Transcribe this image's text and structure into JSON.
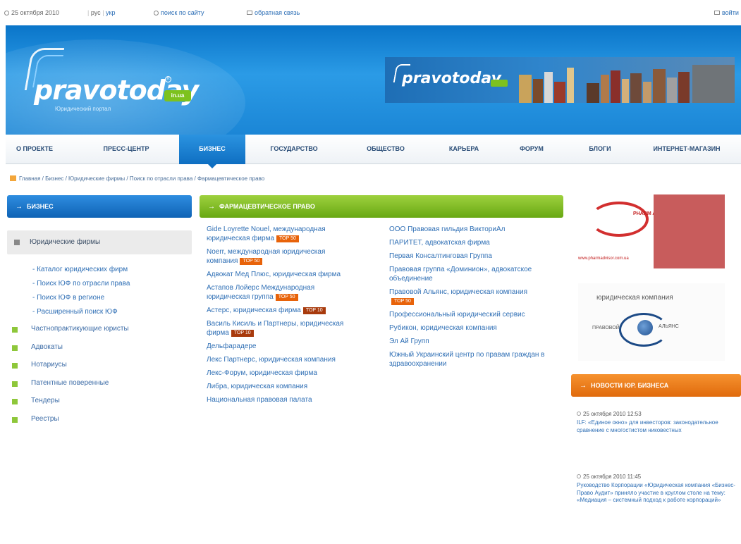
{
  "topbar": {
    "date": "25 октября 2010",
    "lang_ru": "рус",
    "lang_ua": "укр",
    "search": "поиск по сайту",
    "feedback": "обратная связь",
    "login": "войти"
  },
  "header": {
    "logo_text": "pravotoday",
    "logo_badge": "in.ua",
    "logo_subtitle": "Юридический портал",
    "banner_text": "pravotoday"
  },
  "nav": {
    "items": [
      "О ПРОЕКТЕ",
      "ПРЕСС-ЦЕНТР",
      "БИЗНЕС",
      "ГОСУДАРСТВО",
      "ОБЩЕСТВО",
      "КАРЬЕРА",
      "ФОРУМ",
      "БЛОГИ",
      "ИНТЕРНЕТ-МАГАЗИН"
    ],
    "active": "БИЗНЕС"
  },
  "breadcrumb": "Главная / Бизнес / Юридические фирмы / Поиск по отрасли права / Фармацевтическое право",
  "left": {
    "header": "БИЗНЕС",
    "active_item": "Юридические фирмы",
    "subitems": [
      "- Каталог юридических фирм",
      "- Поиск ЮФ по отрасли права",
      "- Поиск ЮФ в регионе",
      "- Расширенный поиск ЮФ"
    ],
    "menu": [
      "Частнопрактикующие юристы",
      "Адвокаты",
      "Нотариусы",
      "Патентные поверенные",
      "Тендеры",
      "Реестры"
    ]
  },
  "main": {
    "header": "ФАРМАЦЕВТИЧЕСКОЕ ПРАВО",
    "col1": [
      {
        "name": "Gide Loyrette Nouel, международная юридическая фирма",
        "badge": "TOP 50"
      },
      {
        "name": "Noerr, международная юридическая компания",
        "badge": "TOP 50"
      },
      {
        "name": "Адвокат Мед Плюс, юридическая фирма",
        "badge": ""
      },
      {
        "name": "Астапов Лойерс Международная юридическая группа",
        "badge": "TOP 50"
      },
      {
        "name": "Астерс, юридическая фирма",
        "badge": "TOP 10"
      },
      {
        "name": "Василь Кисиль и Партнеры, юридическая фирма",
        "badge": "TOP 10"
      },
      {
        "name": "Дельфарадере",
        "badge": ""
      },
      {
        "name": "Лекс Партнерс, юридическая компания",
        "badge": ""
      },
      {
        "name": "Лекс-Форум, юридическая фирма",
        "badge": ""
      },
      {
        "name": "Либра, юридическая компания",
        "badge": ""
      },
      {
        "name": "Национальная правовая палата",
        "badge": ""
      }
    ],
    "col2": [
      {
        "name": "ООО Правовая гильдия ВикториАл",
        "badge": ""
      },
      {
        "name": "ПАРИТЕТ, адвокатская фирма",
        "badge": ""
      },
      {
        "name": "Первая Консалтинговая Группа",
        "badge": ""
      },
      {
        "name": "Правовая группа «Доминион», адвокатское объединение",
        "badge": ""
      },
      {
        "name": "Правовой Альянс, юридическая компания",
        "badge": "TOP 50"
      },
      {
        "name": "Профессиональный юридический сервис",
        "badge": ""
      },
      {
        "name": "Рубикон, юридическая компания",
        "badge": ""
      },
      {
        "name": "Эл Ай Групп",
        "badge": ""
      },
      {
        "name": "Южный Украинский центр по правам граждан в здравоохранении",
        "badge": ""
      }
    ]
  },
  "right": {
    "ad1_brand": "PHARM ADVISOR",
    "ad1_url": "www.pharmadvisor.com.ua",
    "ad2_title": "юридическая компания",
    "ad2_word1": "ПРАВОВОЙ",
    "ad2_word2": "АЛЬЯНС",
    "news_header": "НОВОСТИ ЮР. БИЗНЕСА",
    "news": [
      {
        "date": "25 октября 2010 12:53",
        "text": "ILF: «Единое окно» для инвесторов: законодательное сравнение с многостистом никовестных"
      },
      {
        "date": "25 октября 2010 11:45",
        "text": "Руководство Корпорации «Юридическая компания «Бизнес-Право Аудит» приняло участие в круглом столе на тему: «Медиация – системный подход к работе корпораций»"
      }
    ]
  }
}
